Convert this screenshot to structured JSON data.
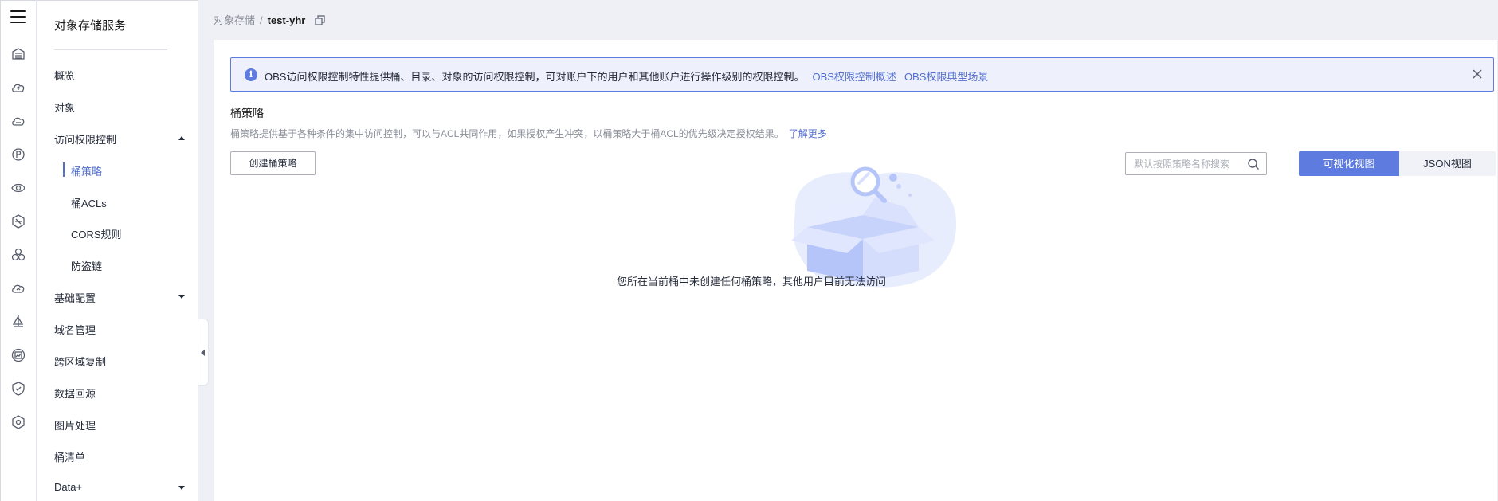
{
  "rail": {
    "menu_icon": "hamburger-icon",
    "icons": [
      "storage-icon",
      "cloud-upload-icon",
      "cloud-icon",
      "settings-icon",
      "eye-icon",
      "hexagon-icon",
      "cluster-icon",
      "cloud-sync-icon",
      "sail-icon",
      "chart-icon",
      "shield-icon",
      "hexagon-gear-icon"
    ]
  },
  "sidebar": {
    "title": "对象存储服务",
    "items": [
      {
        "label": "概览"
      },
      {
        "label": "对象"
      },
      {
        "label": "访问权限控制",
        "expanded": true
      },
      {
        "label": "桶策略",
        "active": true
      },
      {
        "label": "桶ACLs"
      },
      {
        "label": "CORS规则"
      },
      {
        "label": "防盗链"
      },
      {
        "label": "基础配置",
        "expanded": false
      },
      {
        "label": "域名管理"
      },
      {
        "label": "跨区域复制"
      },
      {
        "label": "数据回源"
      },
      {
        "label": "图片处理"
      },
      {
        "label": "桶清单"
      },
      {
        "label": "Data+",
        "expanded": false
      }
    ]
  },
  "breadcrumb": {
    "parent": "对象存储",
    "separator": "/",
    "current": "test-yhr"
  },
  "notice": {
    "text": "OBS访问权限控制特性提供桶、目录、对象的访问权限控制，可对账户下的用户和其他账户进行操作级别的权限控制。",
    "link1": "OBS权限控制概述",
    "link2": "OBS权限典型场景"
  },
  "section": {
    "title": "桶策略",
    "description": "桶策略提供基于各种条件的集中访问控制，可以与ACL共同作用，如果授权产生冲突，以桶策略大于桶ACL的优先级决定授权结果。",
    "learn_more": "了解更多"
  },
  "toolbar": {
    "create_label": "创建桶策略",
    "search_placeholder": "默认按照策略名称搜索",
    "view_visual": "可视化视图",
    "view_json": "JSON视图",
    "selected_view": "可视化视图"
  },
  "empty_state": {
    "message": "您所在当前桶中未创建任何桶策略，其他用户目前无法访问"
  },
  "colors": {
    "accent": "#5e7ce0",
    "link": "#526ecc",
    "notice_bg": "#eef0fc"
  }
}
